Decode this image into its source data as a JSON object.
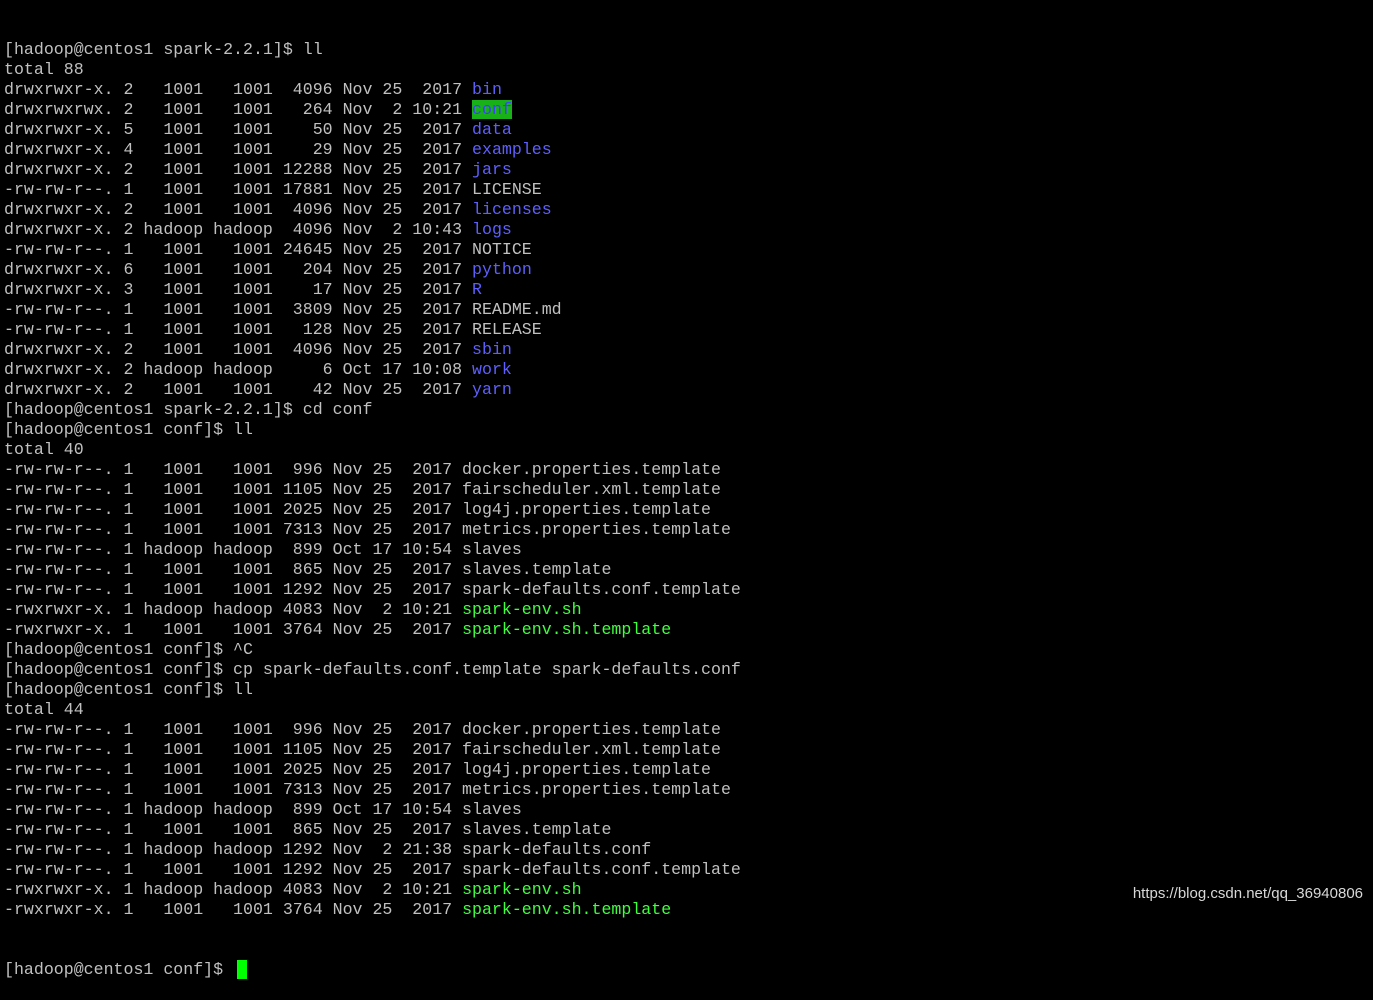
{
  "colors": {
    "background": "#000000",
    "text": "#c0c0c0",
    "directory": "#5f5fff",
    "highlight_bg": "#18b218",
    "executable": "#3fff3f",
    "cursor": "#00ff00"
  },
  "lines": [
    [
      {
        "t": "[hadoop@centos1 spark-2.2.1]$ ll",
        "c": "normal"
      }
    ],
    [
      {
        "t": "total 88",
        "c": "normal"
      }
    ],
    [
      {
        "t": "drwxrwxr-x. 2   1001   1001  4096 Nov 25  2017 ",
        "c": "normal"
      },
      {
        "t": "bin",
        "c": "dir"
      }
    ],
    [
      {
        "t": "drwxrwxrwx. 2   1001   1001   264 Nov  2 10:21 ",
        "c": "normal"
      },
      {
        "t": "conf",
        "c": "dir-hl"
      }
    ],
    [
      {
        "t": "drwxrwxr-x. 5   1001   1001    50 Nov 25  2017 ",
        "c": "normal"
      },
      {
        "t": "data",
        "c": "dir"
      }
    ],
    [
      {
        "t": "drwxrwxr-x. 4   1001   1001    29 Nov 25  2017 ",
        "c": "normal"
      },
      {
        "t": "examples",
        "c": "dir"
      }
    ],
    [
      {
        "t": "drwxrwxr-x. 2   1001   1001 12288 Nov 25  2017 ",
        "c": "normal"
      },
      {
        "t": "jars",
        "c": "dir"
      }
    ],
    [
      {
        "t": "-rw-rw-r--. 1   1001   1001 17881 Nov 25  2017 LICENSE",
        "c": "normal"
      }
    ],
    [
      {
        "t": "drwxrwxr-x. 2   1001   1001  4096 Nov 25  2017 ",
        "c": "normal"
      },
      {
        "t": "licenses",
        "c": "dir"
      }
    ],
    [
      {
        "t": "drwxrwxr-x. 2 hadoop hadoop  4096 Nov  2 10:43 ",
        "c": "normal"
      },
      {
        "t": "logs",
        "c": "dir"
      }
    ],
    [
      {
        "t": "-rw-rw-r--. 1   1001   1001 24645 Nov 25  2017 NOTICE",
        "c": "normal"
      }
    ],
    [
      {
        "t": "drwxrwxr-x. 6   1001   1001   204 Nov 25  2017 ",
        "c": "normal"
      },
      {
        "t": "python",
        "c": "dir"
      }
    ],
    [
      {
        "t": "drwxrwxr-x. 3   1001   1001    17 Nov 25  2017 ",
        "c": "normal"
      },
      {
        "t": "R",
        "c": "dir"
      }
    ],
    [
      {
        "t": "-rw-rw-r--. 1   1001   1001  3809 Nov 25  2017 README.md",
        "c": "normal"
      }
    ],
    [
      {
        "t": "-rw-rw-r--. 1   1001   1001   128 Nov 25  2017 RELEASE",
        "c": "normal"
      }
    ],
    [
      {
        "t": "drwxrwxr-x. 2   1001   1001  4096 Nov 25  2017 ",
        "c": "normal"
      },
      {
        "t": "sbin",
        "c": "dir"
      }
    ],
    [
      {
        "t": "drwxrwxr-x. 2 hadoop hadoop     6 Oct 17 10:08 ",
        "c": "normal"
      },
      {
        "t": "work",
        "c": "dir"
      }
    ],
    [
      {
        "t": "drwxrwxr-x. 2   1001   1001    42 Nov 25  2017 ",
        "c": "normal"
      },
      {
        "t": "yarn",
        "c": "dir"
      }
    ],
    [
      {
        "t": "[hadoop@centos1 spark-2.2.1]$ cd conf",
        "c": "normal"
      }
    ],
    [
      {
        "t": "[hadoop@centos1 conf]$ ll",
        "c": "normal"
      }
    ],
    [
      {
        "t": "total 40",
        "c": "normal"
      }
    ],
    [
      {
        "t": "-rw-rw-r--. 1   1001   1001  996 Nov 25  2017 docker.properties.template",
        "c": "normal"
      }
    ],
    [
      {
        "t": "-rw-rw-r--. 1   1001   1001 1105 Nov 25  2017 fairscheduler.xml.template",
        "c": "normal"
      }
    ],
    [
      {
        "t": "-rw-rw-r--. 1   1001   1001 2025 Nov 25  2017 log4j.properties.template",
        "c": "normal"
      }
    ],
    [
      {
        "t": "-rw-rw-r--. 1   1001   1001 7313 Nov 25  2017 metrics.properties.template",
        "c": "normal"
      }
    ],
    [
      {
        "t": "-rw-rw-r--. 1 hadoop hadoop  899 Oct 17 10:54 slaves",
        "c": "normal"
      }
    ],
    [
      {
        "t": "-rw-rw-r--. 1   1001   1001  865 Nov 25  2017 slaves.template",
        "c": "normal"
      }
    ],
    [
      {
        "t": "-rw-rw-r--. 1   1001   1001 1292 Nov 25  2017 spark-defaults.conf.template",
        "c": "normal"
      }
    ],
    [
      {
        "t": "-rwxrwxr-x. 1 hadoop hadoop 4083 Nov  2 10:21 ",
        "c": "normal"
      },
      {
        "t": "spark-env.sh",
        "c": "exec"
      }
    ],
    [
      {
        "t": "-rwxrwxr-x. 1   1001   1001 3764 Nov 25  2017 ",
        "c": "normal"
      },
      {
        "t": "spark-env.sh.template",
        "c": "exec"
      }
    ],
    [
      {
        "t": "[hadoop@centos1 conf]$ ^C",
        "c": "normal"
      }
    ],
    [
      {
        "t": "[hadoop@centos1 conf]$ cp spark-defaults.conf.template spark-defaults.conf",
        "c": "normal"
      }
    ],
    [
      {
        "t": "[hadoop@centos1 conf]$ ll",
        "c": "normal"
      }
    ],
    [
      {
        "t": "total 44",
        "c": "normal"
      }
    ],
    [
      {
        "t": "-rw-rw-r--. 1   1001   1001  996 Nov 25  2017 docker.properties.template",
        "c": "normal"
      }
    ],
    [
      {
        "t": "-rw-rw-r--. 1   1001   1001 1105 Nov 25  2017 fairscheduler.xml.template",
        "c": "normal"
      }
    ],
    [
      {
        "t": "-rw-rw-r--. 1   1001   1001 2025 Nov 25  2017 log4j.properties.template",
        "c": "normal"
      }
    ],
    [
      {
        "t": "-rw-rw-r--. 1   1001   1001 7313 Nov 25  2017 metrics.properties.template",
        "c": "normal"
      }
    ],
    [
      {
        "t": "-rw-rw-r--. 1 hadoop hadoop  899 Oct 17 10:54 slaves",
        "c": "normal"
      }
    ],
    [
      {
        "t": "-rw-rw-r--. 1   1001   1001  865 Nov 25  2017 slaves.template",
        "c": "normal"
      }
    ],
    [
      {
        "t": "-rw-rw-r--. 1 hadoop hadoop 1292 Nov  2 21:38 spark-defaults.conf",
        "c": "normal"
      }
    ],
    [
      {
        "t": "-rw-rw-r--. 1   1001   1001 1292 Nov 25  2017 spark-defaults.conf.template",
        "c": "normal"
      }
    ],
    [
      {
        "t": "-rwxrwxr-x. 1 hadoop hadoop 4083 Nov  2 10:21 ",
        "c": "normal"
      },
      {
        "t": "spark-env.sh",
        "c": "exec"
      }
    ],
    [
      {
        "t": "-rwxrwxr-x. 1   1001   1001 3764 Nov 25  2017 ",
        "c": "normal"
      },
      {
        "t": "spark-env.sh.template",
        "c": "exec"
      }
    ]
  ],
  "prompt": "[hadoop@centos1 conf]$ ",
  "watermark": "https://blog.csdn.net/qq_36940806"
}
